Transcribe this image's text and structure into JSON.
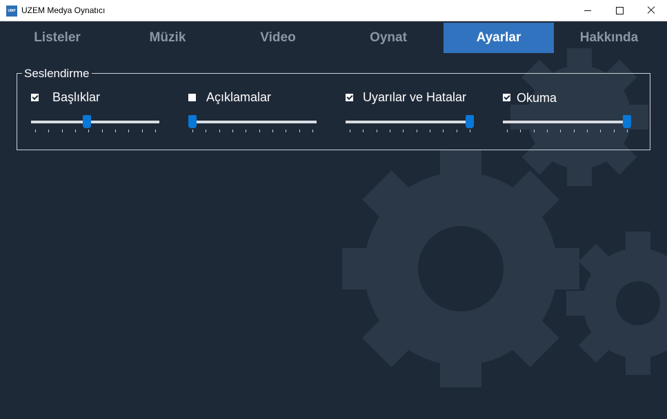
{
  "window": {
    "title": "UZEM Medya Oynatıcı",
    "icon_text": "UMP",
    "controls": [
      "minimize-icon",
      "maximize-icon",
      "close-icon"
    ]
  },
  "tabs": [
    {
      "label": "Listeler",
      "active": false
    },
    {
      "label": "Müzik",
      "active": false
    },
    {
      "label": "Video",
      "active": false
    },
    {
      "label": "Oynat",
      "active": false
    },
    {
      "label": "Ayarlar",
      "active": true
    },
    {
      "label": "Hakkında",
      "active": false
    }
  ],
  "settings": {
    "group_title": "Seslendirme",
    "items": [
      {
        "label": "Başlıklar",
        "checked": true,
        "volume": 0.43
      },
      {
        "label": "Açıklamalar",
        "checked": false,
        "volume": 0.0
      },
      {
        "label": "Uyarılar ve Hatalar",
        "checked": true,
        "volume": 1.0
      },
      {
        "label": "Okuma",
        "checked": true,
        "volume": 1.0
      }
    ]
  },
  "colors": {
    "background": "#1e2938",
    "active_tab": "#3173be",
    "inactive_tab_text": "#8b97a6",
    "slider_thumb": "#0a78d7",
    "gear": "#2b3847"
  },
  "icons": {
    "app": "app-icon",
    "background": "gear-icon"
  }
}
